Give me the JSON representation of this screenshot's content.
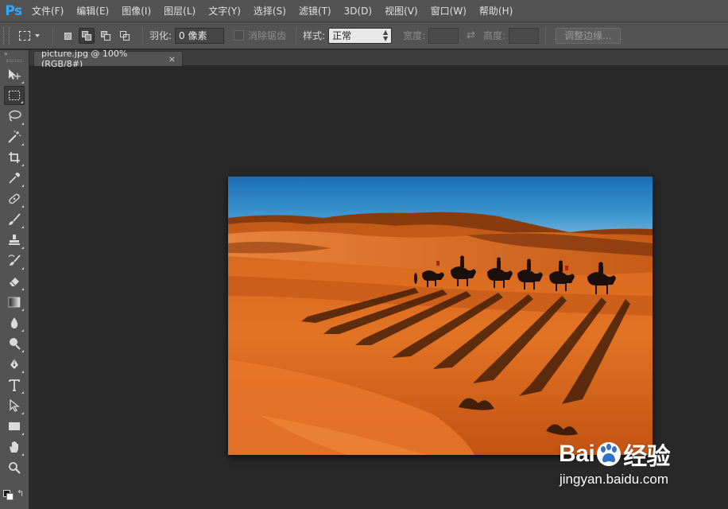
{
  "app": {
    "logo": "Ps"
  },
  "menu": [
    "文件(F)",
    "编辑(E)",
    "图像(I)",
    "图层(L)",
    "文字(Y)",
    "选择(S)",
    "滤镜(T)",
    "3D(D)",
    "视图(V)",
    "窗口(W)",
    "帮助(H)"
  ],
  "options": {
    "feather_label": "羽化:",
    "feather_value": "0 像素",
    "antialias_label": "消除锯齿",
    "style_label": "样式:",
    "style_value": "正常",
    "width_label": "宽度:",
    "height_label": "高度:",
    "refine_edge_button": "调整边缘..."
  },
  "document": {
    "tab_title": "picture.jpg @ 100%(RGB/8#)",
    "close_glyph": "×"
  },
  "toolbar": {
    "collapse_glyph": "»",
    "tools": [
      "move-tool",
      "rectangular-marquee-tool",
      "lasso-tool",
      "magic-wand-tool",
      "crop-tool",
      "eyedropper-tool",
      "spot-healing-tool",
      "brush-tool",
      "clone-stamp-tool",
      "history-brush-tool",
      "eraser-tool",
      "gradient-tool",
      "blur-tool",
      "dodge-tool",
      "pen-tool",
      "type-tool",
      "path-selection-tool",
      "rectangle-tool",
      "hand-tool",
      "zoom-tool"
    ],
    "selected_tool": "rectangular-marquee-tool",
    "foreground_color": "#1a1a1a",
    "background_color": "#ffffff"
  },
  "watermark": {
    "logo_left": "Bai",
    "logo_right": "经验",
    "url": "jingyan.baidu.com"
  },
  "colors": {
    "ui_panel": "#535353",
    "workspace": "#282828",
    "ps_blue": "#31a8ff"
  }
}
